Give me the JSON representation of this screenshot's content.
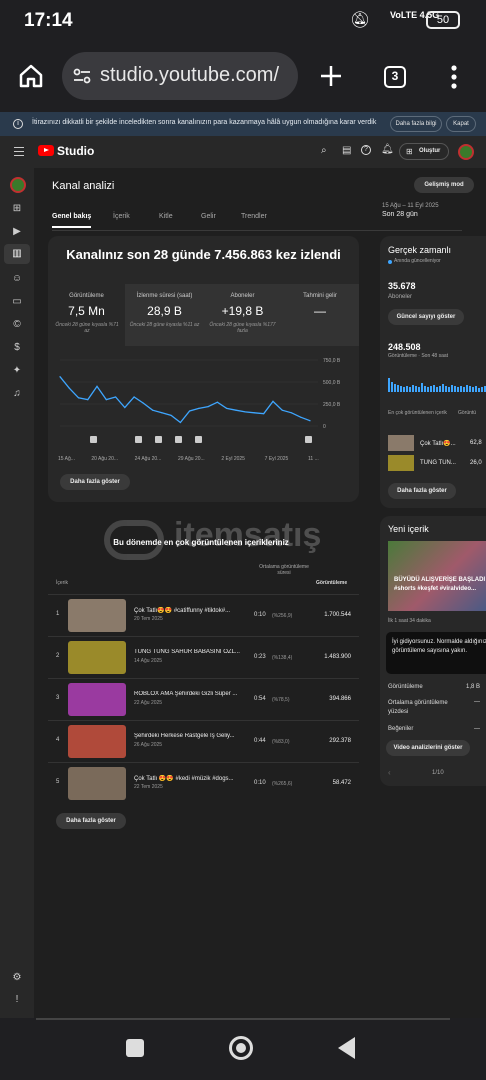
{
  "status": {
    "time": "17:14",
    "network": "VoLTE 4.5G",
    "battery": "50"
  },
  "browser": {
    "url": "studio.youtube.com/",
    "tab_count": "3"
  },
  "banner": {
    "text": "İtirazınızı dikkatli bir şekilde inceledikten sonra kanalınızın para kazanmaya hâlâ uygun olmadığına karar verdik",
    "more_label": "Daha fazla bilgi",
    "close_label": "Kapat"
  },
  "header": {
    "logo": "Studio",
    "create_label": "Oluştur"
  },
  "analytics": {
    "title": "Kanal analizi",
    "advanced_label": "Gelişmiş mod",
    "date_range": "15 Ağu – 11 Eyl 2025",
    "period": "Son 28 gün",
    "tabs": [
      "Genel bakış",
      "İçerik",
      "Kitle",
      "Gelir",
      "Trendler"
    ],
    "headline": "Kanalınız son 28 günde 7.456.863 kez izlendi",
    "metrics": [
      {
        "label": "Görüntüleme",
        "value": "7,5 Mn",
        "sub": "Önceki 28 güne kıyasla %71 az"
      },
      {
        "label": "İzlenme süresi (saat)",
        "value": "28,9 B",
        "sub": "Önceki 28 güne kıyasla %11 az"
      },
      {
        "label": "Aboneler",
        "value": "+19,8 B",
        "sub": "Önceki 28 güne kıyasla %177 fazla"
      },
      {
        "label": "Tahmini gelir",
        "value": "—",
        "sub": ""
      }
    ],
    "show_more": "Daha fazla göster"
  },
  "chart_data": {
    "type": "line",
    "x": [
      "15 Ağu",
      "16 Ağu",
      "17 Ağu",
      "18 Ağu",
      "19 Ağu",
      "20 Ağu",
      "21 Ağu",
      "22 Ağu",
      "23 Ağu",
      "24 Ağu",
      "25 Ağu",
      "26 Ağu",
      "27 Ağu",
      "28 Ağu",
      "29 Ağu",
      "30 Ağu",
      "31 Ağu",
      "1 Eyl",
      "2 Eyl",
      "3 Eyl",
      "4 Eyl",
      "5 Eyl",
      "6 Eyl",
      "7 Eyl",
      "8 Eyl",
      "9 Eyl",
      "10 Eyl",
      "11 Eyl"
    ],
    "values": [
      560000,
      430000,
      320000,
      300000,
      450000,
      300000,
      330000,
      210000,
      330000,
      260000,
      180000,
      150000,
      120000,
      40000,
      170000,
      200000,
      220000,
      270000,
      200000,
      180000,
      160000,
      150000,
      140000,
      280000,
      180000,
      150000,
      100000,
      60000
    ],
    "x_tick_labels": [
      "15 Ağ...",
      "20 Ağu 20...",
      "24 Ağu 20...",
      "29 Ağu 20...",
      "2 Eyl 2025",
      "7 Eyl 2025",
      "11 ..."
    ],
    "y_tick_labels": [
      "750,0 B",
      "500,0 B",
      "250,0 B",
      "0"
    ],
    "ylim": [
      0,
      750000
    ],
    "color": "#3ea6ff",
    "grid": true
  },
  "top_content": {
    "title": "Bu dönemde en çok görüntülenen içerikleriniz",
    "col_content": "İçerik",
    "col_avg": "Ortalama görüntüleme süresi",
    "col_views": "Görüntüleme",
    "rows": [
      {
        "n": "1",
        "title": "Çok Tatlı😍😍 #catiffunny #tiktok#...",
        "date": "20 Tem 2025",
        "dur": "0:10",
        "pct": "(%256,9)",
        "views": "1.700.544",
        "color": "#8a7a6a"
      },
      {
        "n": "2",
        "title": "TUNG TUNG SAHUR BABASINI ÖZL...",
        "date": "14 Ağu 2025",
        "dur": "0:23",
        "pct": "(%138,4)",
        "views": "1.483.900",
        "color": "#9a8a2a"
      },
      {
        "n": "3",
        "title": "ROBLOX AMA Şehirdeki Gizli Süper ...",
        "date": "22 Ağu 2025",
        "dur": "0:54",
        "pct": "(%78,5)",
        "views": "394.866",
        "color": "#9a3aa0"
      },
      {
        "n": "4",
        "title": "Şehirdeki Herkese Rastgele İş Geliy...",
        "date": "26 Ağu 2025",
        "dur": "0:44",
        "pct": "(%83,0)",
        "views": "292.378",
        "color": "#b04a3a"
      },
      {
        "n": "5",
        "title": "Çok Tatlı 😍😍 #kedi #müzik #dogs...",
        "date": "22 Tem 2025",
        "dur": "0:10",
        "pct": "(%265,6)",
        "views": "58.472",
        "color": "#7a6a5a"
      }
    ],
    "show_more": "Daha fazla göster"
  },
  "realtime": {
    "title": "Gerçek zamanlı",
    "live": "Anında güncelleniyor",
    "subs": "35.678",
    "subs_label": "Aboneler",
    "subs_btn": "Güncel sayıyı göster",
    "views": "248.508",
    "views_label": "Görüntüleme · Son 48 saat",
    "col_content": "En çok görüntülenen içerik",
    "col_views": "Görüntü",
    "items": [
      {
        "title": "Çok Tatlı😍...",
        "views": "62,8"
      },
      {
        "title": "TUNG TUN...",
        "views": "26,0"
      }
    ],
    "btn": "Daha fazla göster"
  },
  "latest": {
    "title": "Yeni içerik",
    "video_title": "BÜYÜDÜ ALIŞVERİŞE BAŞLADI #shorts #keşfet #viralvideo...",
    "since": "İlk 1 saat 34 dakika",
    "notice": "İyi gidiyorsunuz. Normalde aldığınız görüntüleme sayısına yakın.",
    "stats": [
      {
        "label": "Görüntüleme",
        "value": "1,8 B"
      },
      {
        "label": "Ortalama görüntüleme yüzdesi",
        "value": "—"
      },
      {
        "label": "Beğeniler",
        "value": "—"
      }
    ],
    "btn": "Video analizlerini göster",
    "pager": "1/10"
  },
  "watermark": "itemsatış"
}
